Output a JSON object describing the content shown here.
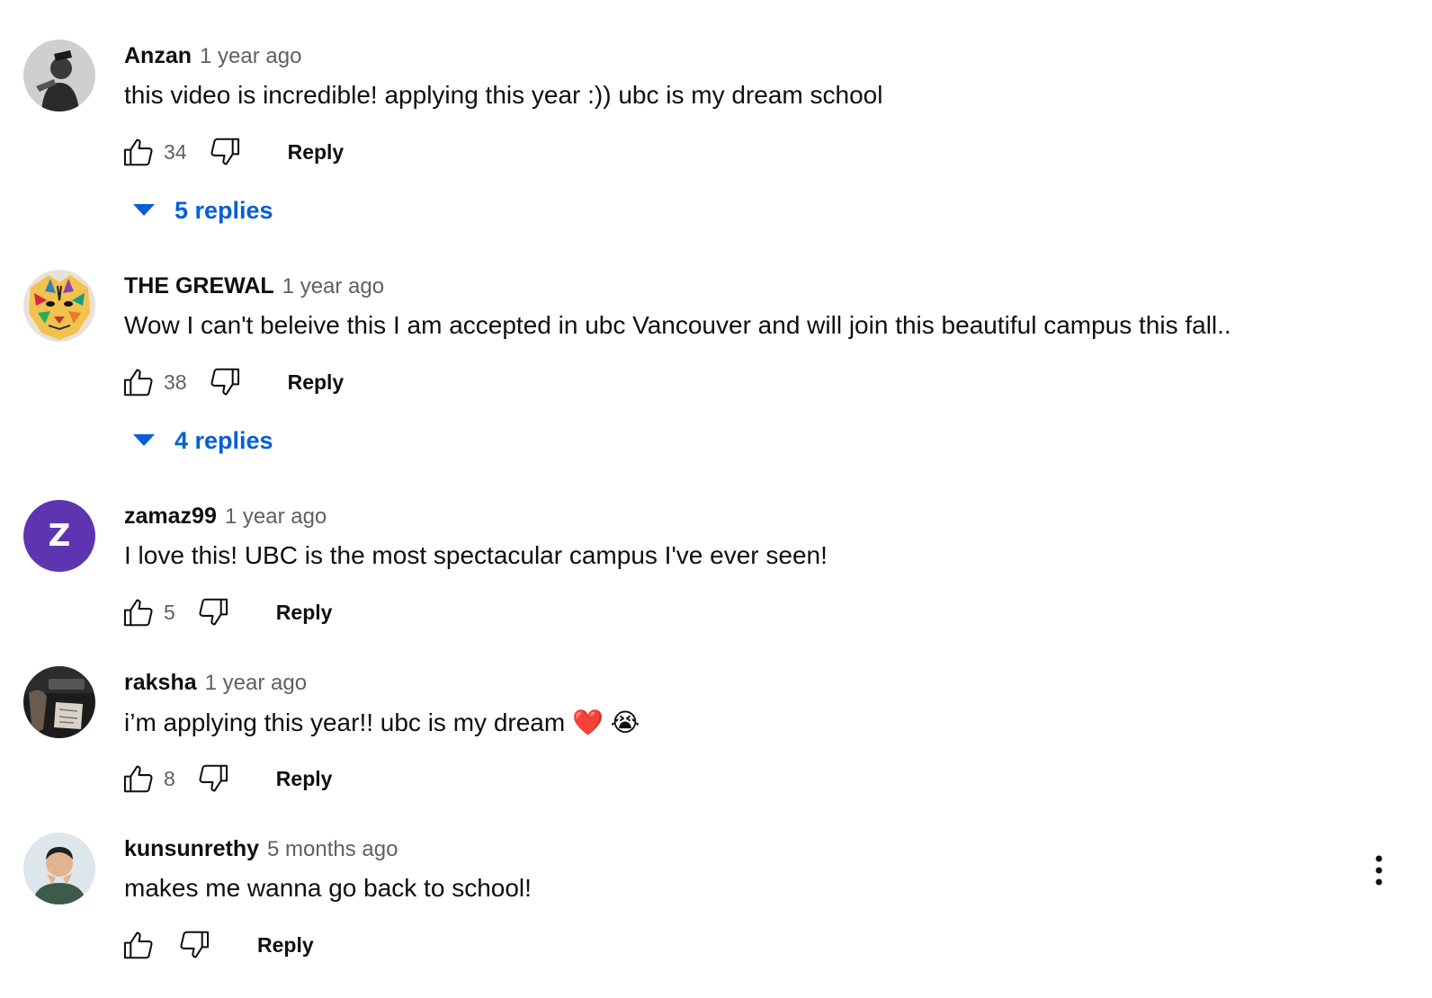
{
  "comments": [
    {
      "author": "Anzan",
      "time": "1 year ago",
      "text": "this video is incredible! applying this year :)) ubc is my dream school",
      "likes": "34",
      "reply_label": "Reply",
      "replies_label": "5 replies",
      "avatar_icon": "photo-avatar-icon"
    },
    {
      "author": "THE GREWAL",
      "time": "1 year ago",
      "text": "Wow I can't beleive this I am accepted in ubc Vancouver and will join this beautiful campus this fall..",
      "likes": "38",
      "reply_label": "Reply",
      "replies_label": "4 replies",
      "avatar_icon": "tiger-avatar-icon"
    },
    {
      "author": "zamaz99",
      "time": "1 year ago",
      "text": "I love this! UBC is the most spectacular campus I've ever seen!",
      "likes": "5",
      "reply_label": "Reply",
      "avatar_letter": "Z",
      "avatar_color": "#5e35b1"
    },
    {
      "author": "raksha",
      "time": "1 year ago",
      "text": "i’m applying this year!! ubc is my dream ❤️ 😭",
      "likes": "8",
      "reply_label": "Reply",
      "avatar_icon": "photo-avatar-icon"
    },
    {
      "author": "kunsunrethy",
      "time": "5 months ago",
      "text": "makes me wanna go back to school!",
      "likes": "",
      "reply_label": "Reply",
      "avatar_icon": "person-avatar-icon"
    }
  ],
  "colors": {
    "link_blue": "#065fd4",
    "secondary_text": "#606060",
    "primary_text": "#0f0f0f"
  },
  "icons": {
    "like": "thumbs-up-icon",
    "dislike": "thumbs-down-icon",
    "expand": "caret-down-icon",
    "menu": "more-vert-icon"
  }
}
